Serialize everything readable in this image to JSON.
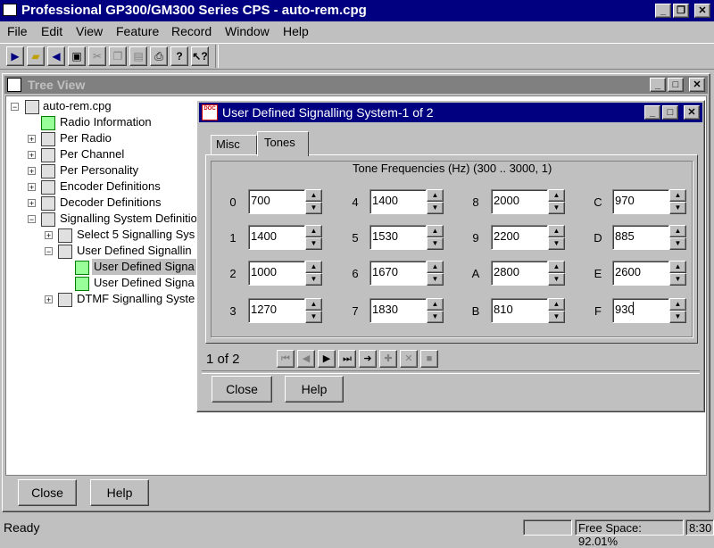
{
  "app": {
    "title": "Professional GP300/GM300 Series CPS - auto-rem.cpg",
    "menu": [
      "File",
      "Edit",
      "View",
      "Feature",
      "Record",
      "Window",
      "Help"
    ]
  },
  "toolbar": {
    "buttons": [
      "new-radio-icon",
      "open-icon",
      "read-radio-icon",
      "save-icon",
      "cut-icon",
      "copy-icon",
      "paste-icon",
      "print-icon",
      "help-icon",
      "context-help-icon"
    ]
  },
  "tree_view": {
    "title": "Tree View",
    "items": [
      {
        "label": "auto-rem.cpg"
      },
      {
        "label": "Radio Information"
      },
      {
        "label": "Per Radio"
      },
      {
        "label": "Per Channel"
      },
      {
        "label": "Per Personality"
      },
      {
        "label": "Encoder Definitions"
      },
      {
        "label": "Decoder Definitions"
      },
      {
        "label": "Signalling System Definitio"
      },
      {
        "label": "Select 5 Signalling Sys"
      },
      {
        "label": "User Defined Signallin"
      },
      {
        "label": "User Defined Signa"
      },
      {
        "label": "User Defined Signa"
      },
      {
        "label": "DTMF Signalling Syste"
      }
    ],
    "close_label": "Close",
    "help_label": "Help"
  },
  "dialog": {
    "title": "User Defined Signalling System-1 of 2",
    "tabs": [
      {
        "label": "Misc"
      },
      {
        "label": "Tones"
      }
    ],
    "active_tab": "Tones",
    "group_title": "Tone Frequencies (Hz) (300 .. 3000, 1)",
    "tones": [
      {
        "key": "0",
        "value": "700"
      },
      {
        "key": "1",
        "value": "1400"
      },
      {
        "key": "2",
        "value": "1000"
      },
      {
        "key": "3",
        "value": "1270"
      },
      {
        "key": "4",
        "value": "1400"
      },
      {
        "key": "5",
        "value": "1530"
      },
      {
        "key": "6",
        "value": "1670"
      },
      {
        "key": "7",
        "value": "1830"
      },
      {
        "key": "8",
        "value": "2000"
      },
      {
        "key": "9",
        "value": "2200"
      },
      {
        "key": "A",
        "value": "2800"
      },
      {
        "key": "B",
        "value": "810"
      },
      {
        "key": "C",
        "value": "970"
      },
      {
        "key": "D",
        "value": "885"
      },
      {
        "key": "E",
        "value": "2600"
      },
      {
        "key": "F",
        "value": "930"
      }
    ],
    "record_nav": "1 of 2",
    "close_label": "Close",
    "help_label": "Help"
  },
  "status": {
    "text": "Ready",
    "free_space": "Free Space: 92.01%",
    "time": "8:30"
  }
}
